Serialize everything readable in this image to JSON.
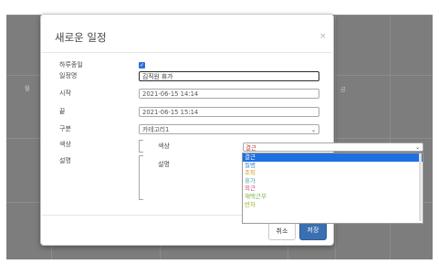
{
  "calendar": {
    "day_left": "월",
    "day_right": "금"
  },
  "modal": {
    "title": "새로운 일정",
    "close": "×",
    "allday_label": "하루종일",
    "name_label": "일정명",
    "name_value": "김직원 휴가",
    "start_label": "시작",
    "start_value": "2021-06-15 14:14",
    "end_label": "끝",
    "end_value": "2021-06-15 15:14",
    "category_label": "구분",
    "category_value": "카테고리1",
    "color_label": "색상",
    "desc_label": "설명",
    "cancel_label": "취소",
    "save_label": "저장"
  },
  "subform": {
    "color_label": "색상",
    "desc_label": "설명"
  },
  "color_select": {
    "value": "결근",
    "options": [
      {
        "label": "결근",
        "color": "#ffffff"
      },
      {
        "label": "질병",
        "color": "#2f7fd0"
      },
      {
        "label": "조퇴",
        "color": "#d49a1a"
      },
      {
        "label": "휴가",
        "color": "#3aa0a8"
      },
      {
        "label": "외근",
        "color": "#d44a88"
      },
      {
        "label": "재택근무",
        "color": "#7bb34c"
      },
      {
        "label": "반차",
        "color": "#a0b52a"
      }
    ]
  },
  "colors": {
    "accent": "#3a6fb0",
    "backdrop": "#7d7d7d",
    "checkbox": "#2f6de0",
    "selected_option": "#1f6fe0"
  }
}
